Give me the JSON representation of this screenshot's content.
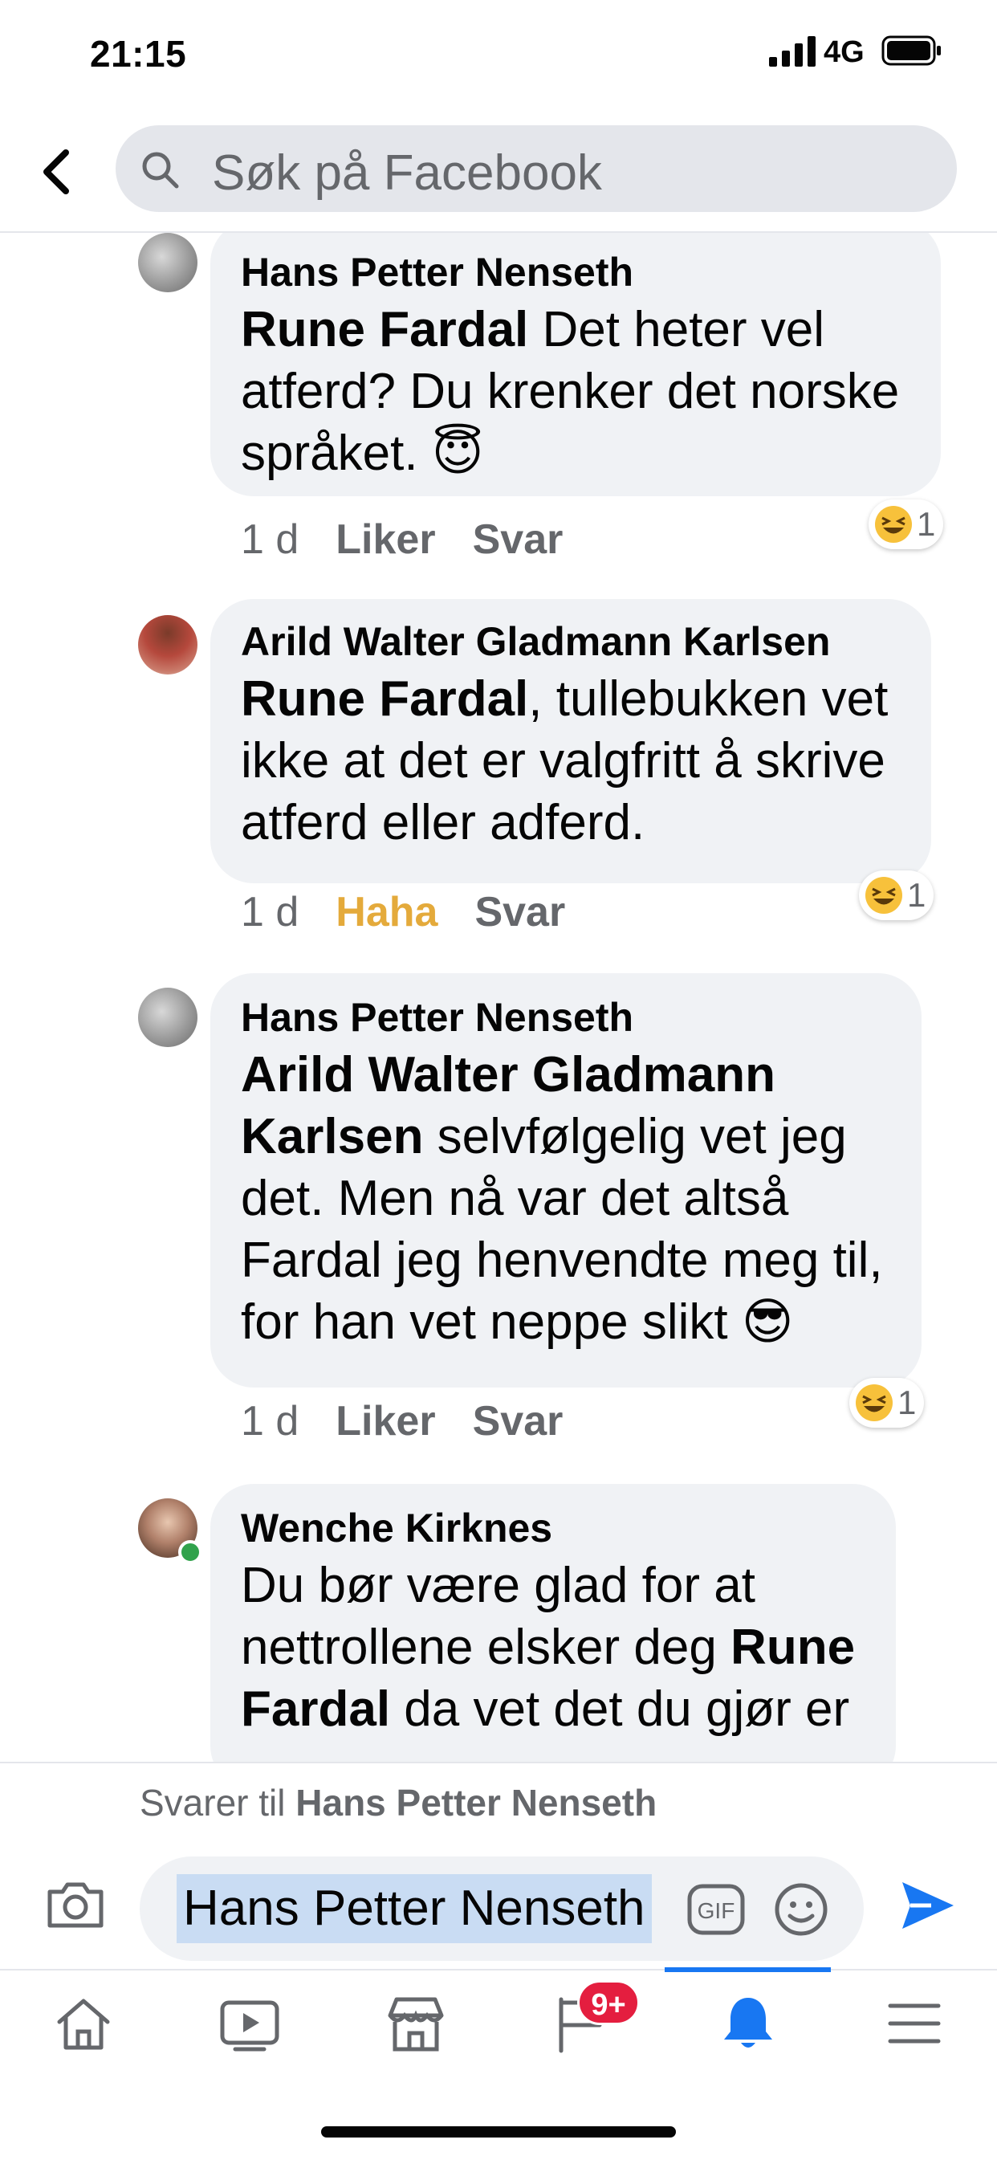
{
  "status_bar": {
    "time": "21:15",
    "network": "4G"
  },
  "search": {
    "placeholder": "Søk på Facebook"
  },
  "comments": [
    {
      "author": "Hans Petter Nenseth",
      "mention": "Rune Fardal",
      "text": " Det heter vel atferd? Du krenker det norske språket. 😇",
      "time": "1 d",
      "like_label": "Liker",
      "reply_label": "Svar",
      "reaction": {
        "icon": "haha-emoji-icon",
        "count": "1"
      }
    },
    {
      "author": "Arild Walter Gladmann Karlsen",
      "mention": "Rune Fardal",
      "text": ", tullebukken vet ikke at det er valgfritt å skrive atferd eller adferd.",
      "time": "1 d",
      "like_label": "Haha",
      "reply_label": "Svar",
      "reaction": {
        "icon": "haha-emoji-icon",
        "count": "1"
      }
    },
    {
      "author": "Hans Petter Nenseth",
      "mention": "Arild Walter Gladmann Karlsen",
      "text": " selvfølgelig vet jeg det. Men nå var det altså Fardal jeg henvendte meg til, for han vet neppe slikt 😎",
      "time": "1 d",
      "like_label": "Liker",
      "reply_label": "Svar",
      "reaction": {
        "icon": "haha-emoji-icon",
        "count": "1"
      }
    },
    {
      "author": "Wenche Kirknes",
      "text_before": "Du bør være glad for at nettrollene elsker deg ",
      "mention": "Rune Fardal",
      "text_after": " da vet det du gjør er"
    }
  ],
  "reply": {
    "prefix": "Svarer til ",
    "target": "Hans Petter Nenseth",
    "composer_value": "Hans Petter Nenseth",
    "gif_label": "GIF"
  },
  "tab_bar": {
    "tabs": [
      "home-icon",
      "watch-icon",
      "marketplace-icon",
      "pages-flag-icon",
      "notifications-bell-icon",
      "menu-icon"
    ],
    "pages_badge": "9+",
    "active_tab": "notifications-bell-icon"
  },
  "colors": {
    "accent": "#1877f2",
    "haha": "#e4aa3b",
    "badge": "#e41e3f",
    "bubble": "#f0f2f5"
  }
}
